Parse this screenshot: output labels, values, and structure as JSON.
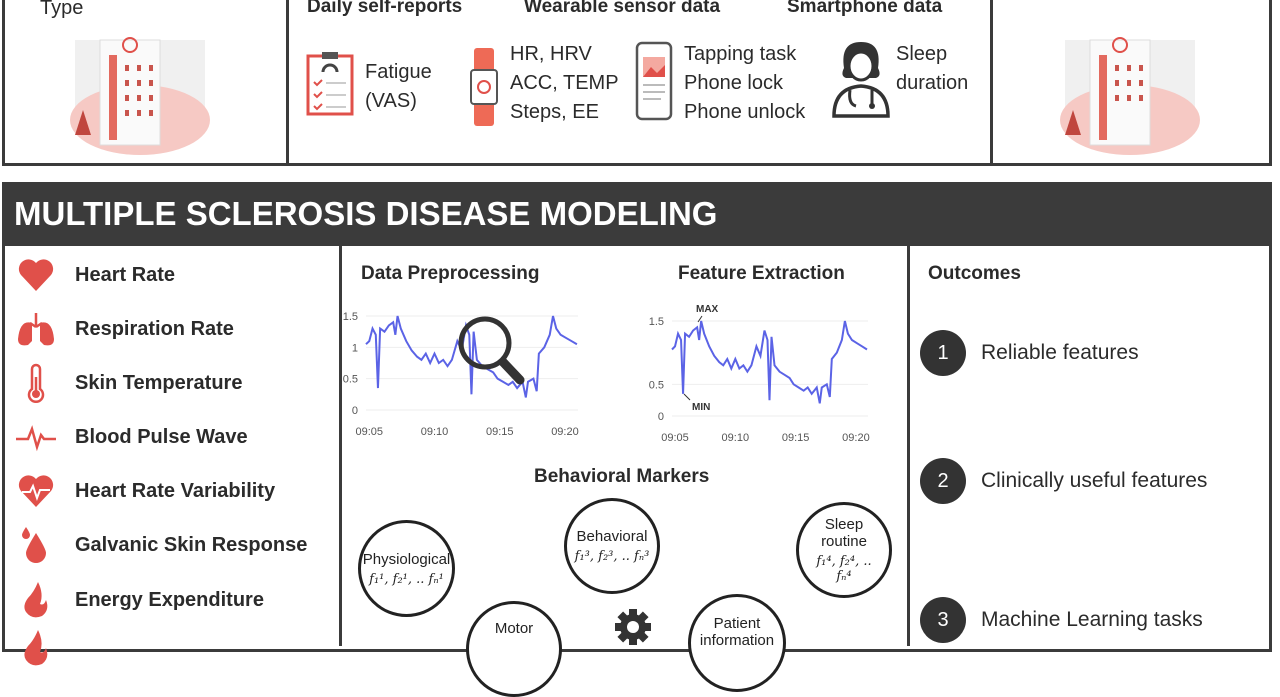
{
  "top": {
    "type_label": "Type",
    "sections": [
      {
        "title": "Daily self-reports",
        "lines": [
          "Fatigue",
          "(VAS)"
        ],
        "icon": "clipboard-icon"
      },
      {
        "title": "Wearable sensor data",
        "lines": [
          "HR, HRV",
          "ACC, TEMP",
          "Steps, EE"
        ],
        "icon": "smartwatch-icon"
      },
      {
        "title": "Smartphone data",
        "lines": [
          "Tapping task",
          "Phone lock",
          "Phone unlock"
        ],
        "icon": "smartphone-icon"
      },
      {
        "title": "",
        "lines": [
          "Sleep",
          "duration"
        ],
        "icon": "doctor-icon"
      }
    ]
  },
  "main": {
    "title": "MULTIPLE SCLEROSIS DISEASE MODELING",
    "signals": [
      {
        "label": "Heart Rate",
        "icon": "heart-icon"
      },
      {
        "label": "Respiration Rate",
        "icon": "lungs-icon"
      },
      {
        "label": "Skin Temperature",
        "icon": "thermometer-icon"
      },
      {
        "label": "Blood Pulse Wave",
        "icon": "pulse-wave-icon"
      },
      {
        "label": "Heart Rate Variability",
        "icon": "heart-pulse-icon"
      },
      {
        "label": "Galvanic Skin Response",
        "icon": "droplets-icon"
      },
      {
        "label": "Energy Expenditure",
        "icon": "flame-icon"
      }
    ],
    "preprocessing_title": "Data Preprocessing",
    "extraction_title": "Feature Extraction",
    "max_label": "MAX",
    "min_label": "MIN",
    "markers_title": "Behavioral Markers",
    "markers": [
      {
        "name": "Physiological",
        "features": "f₁¹, f₂¹, .. fₙ¹"
      },
      {
        "name": "Behavioral",
        "features": "f₁³, f₂³, .. fₙ³"
      },
      {
        "name": "Sleep routine",
        "features": "f₁⁴, f₂⁴, .. fₙ⁴"
      },
      {
        "name": "Motor",
        "features": ""
      },
      {
        "name": "Patient information",
        "features": ""
      }
    ],
    "outcomes_title": "Outcomes",
    "outcomes": [
      {
        "num": "1",
        "label": "Reliable features"
      },
      {
        "num": "2",
        "label": "Clinically useful features"
      },
      {
        "num": "3",
        "label": "Machine Learning tasks"
      }
    ]
  },
  "colors": {
    "accent": "#e0504a",
    "line": "#5b63e6",
    "dark": "#3b3b3b"
  },
  "chart_data": [
    {
      "type": "line",
      "x_ticks": [
        "09:05",
        "09:10",
        "09:15",
        "09:20"
      ],
      "y_ticks": [
        "0",
        "0.5",
        "1",
        "1.5"
      ],
      "ylim": [
        0,
        1.6
      ],
      "grid": true,
      "x": [
        "09:04:45",
        "09:05:00",
        "09:05:15",
        "09:05:30",
        "09:05:40",
        "09:05:50",
        "09:06:10",
        "09:06:30",
        "09:06:50",
        "09:07:00",
        "09:07:10",
        "09:07:25",
        "09:07:50",
        "09:08:15",
        "09:08:40",
        "09:09:00",
        "09:09:20",
        "09:09:40",
        "09:10:00",
        "09:10:20",
        "09:10:40",
        "09:11:00",
        "09:11:20",
        "09:11:45",
        "09:12:05",
        "09:12:25",
        "09:12:40",
        "09:12:50",
        "09:13:00",
        "09:13:15",
        "09:13:40",
        "09:14:05",
        "09:14:30",
        "09:14:50",
        "09:15:15",
        "09:15:40",
        "09:16:00",
        "09:16:20",
        "09:16:45",
        "09:17:00",
        "09:17:10",
        "09:17:35",
        "09:17:50",
        "09:18:00",
        "09:18:25",
        "09:18:50",
        "09:19:05",
        "09:19:20",
        "09:19:40",
        "09:20:05",
        "09:20:30",
        "09:20:55"
      ],
      "y": [
        1.05,
        1.1,
        1.3,
        1.2,
        0.35,
        1.3,
        1.25,
        1.35,
        1.4,
        1.2,
        1.5,
        1.3,
        1.1,
        0.95,
        0.85,
        0.8,
        0.9,
        0.75,
        0.9,
        0.75,
        0.8,
        0.7,
        0.8,
        1.1,
        0.95,
        1.35,
        1.2,
        0.25,
        1.25,
        0.8,
        0.7,
        0.65,
        0.6,
        0.5,
        0.45,
        0.4,
        0.45,
        0.35,
        0.45,
        0.2,
        0.45,
        0.5,
        0.3,
        0.9,
        1.0,
        1.2,
        1.5,
        1.3,
        1.2,
        1.15,
        1.1,
        1.05
      ]
    },
    {
      "type": "line",
      "x_ticks": [
        "09:05",
        "09:10",
        "09:15",
        "09:20"
      ],
      "y_ticks": [
        "0",
        "0.5",
        "1.5"
      ],
      "ylim": [
        0,
        1.6
      ],
      "grid": true,
      "annotations": [
        "MAX",
        "MIN"
      ]
    }
  ]
}
